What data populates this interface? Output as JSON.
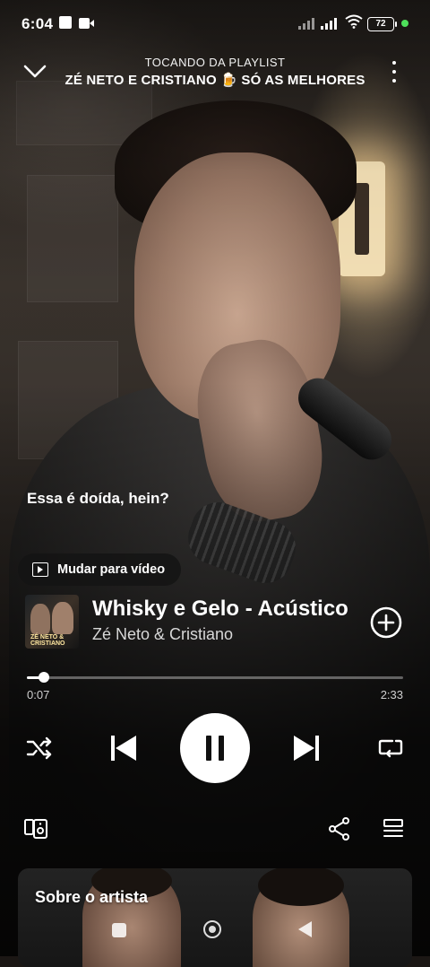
{
  "status_bar": {
    "time": "6:04",
    "battery": "72",
    "icons": [
      "gallery-icon",
      "video-icon",
      "signal-icon",
      "signal-icon",
      "wifi-icon",
      "battery-icon"
    ],
    "dot_color": "#4ee05b"
  },
  "header": {
    "context_label": "TOCANDO DA PLAYLIST",
    "playlist_title": "ZÉ NETO E CRISTIANO 🍺 SÓ AS MELHORES",
    "collapse_icon": "chevron-down-icon",
    "more_icon": "more-vertical-icon"
  },
  "lyric_line": "Essa é doída, hein?",
  "switch_video_label": "Mudar para vídeo",
  "track": {
    "title": "Whisky e Gelo - Acústico",
    "artist": "Zé Neto & Cristiano",
    "cover_text": "ZÉ NETO & CRISTIANO",
    "add_icon": "add-circle-icon"
  },
  "progress": {
    "elapsed": "0:07",
    "total": "2:33",
    "fraction": 0.046
  },
  "controls": {
    "shuffle_icon": "shuffle-icon",
    "previous_icon": "skip-previous-icon",
    "play_pause_icon": "pause-icon",
    "next_icon": "skip-next-icon",
    "repeat_icon": "repeat-icon"
  },
  "actions": {
    "devices_icon": "connect-device-icon",
    "share_icon": "share-icon",
    "queue_icon": "queue-icon"
  },
  "about_artist": {
    "heading": "Sobre o artista"
  },
  "colors": {
    "accent": "#ffffff",
    "background": "#1b1714"
  }
}
